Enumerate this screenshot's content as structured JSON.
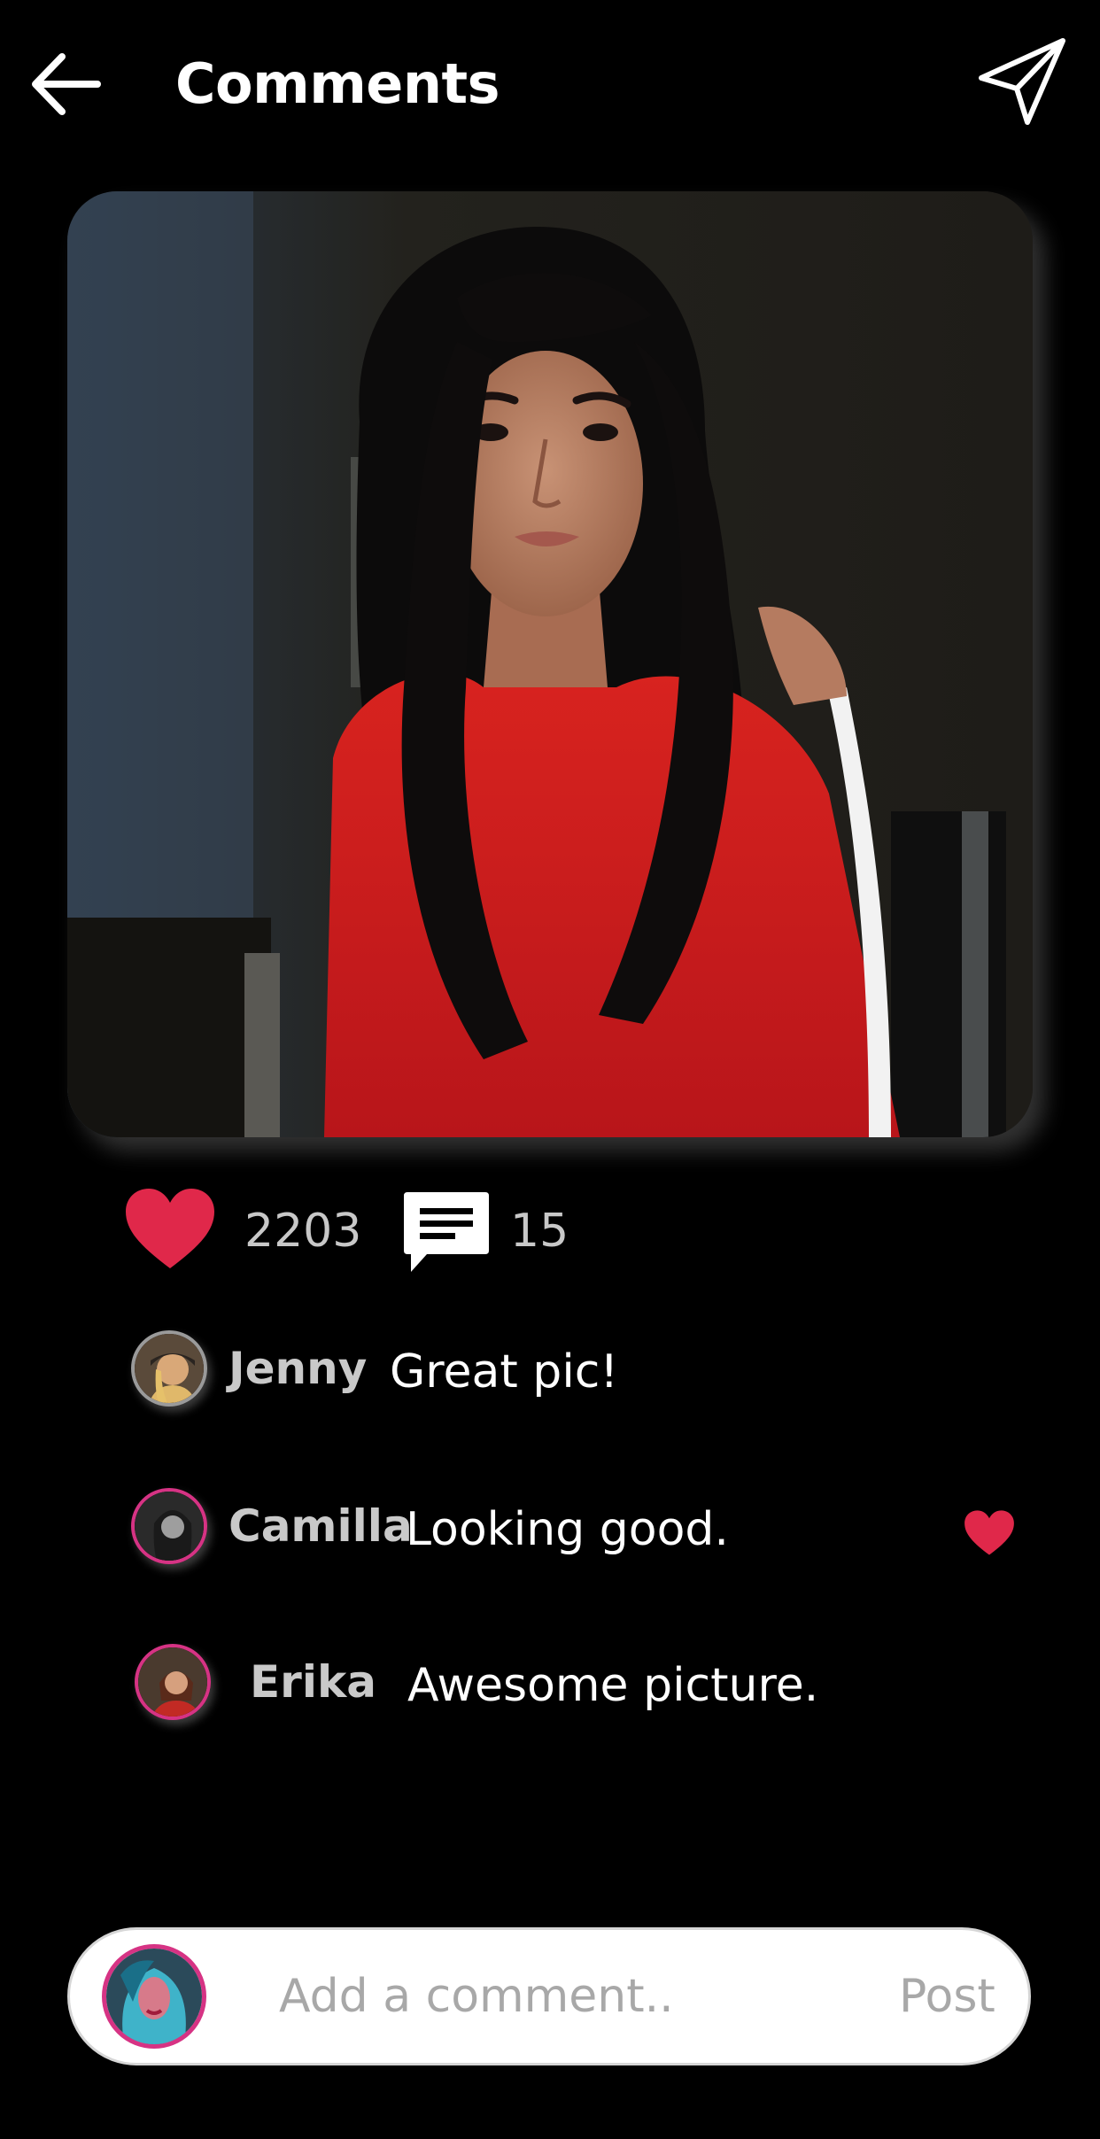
{
  "header": {
    "title": "Comments",
    "back_icon": "arrow-left-icon",
    "send_icon": "paper-plane-icon"
  },
  "post": {
    "image_alt": "Photo of a woman with long dark hair in a red sweatshirt",
    "likes": "2203",
    "comments_count": "15",
    "like_icon": "heart-icon",
    "comment_icon": "comment-bubble-icon"
  },
  "comments": [
    {
      "user": "Jenny",
      "text": "Great pic!"
    },
    {
      "user": "Camilla",
      "text": "Looking good."
    },
    {
      "user": "Erika",
      "text": "Awesome picture."
    }
  ],
  "composer": {
    "placeholder": "Add a comment..",
    "post_label": "Post"
  },
  "colors": {
    "background": "#000000",
    "accent_heart": "#e0284a",
    "avatar_ring": "#d63384",
    "muted_text": "#c8c8c8"
  }
}
